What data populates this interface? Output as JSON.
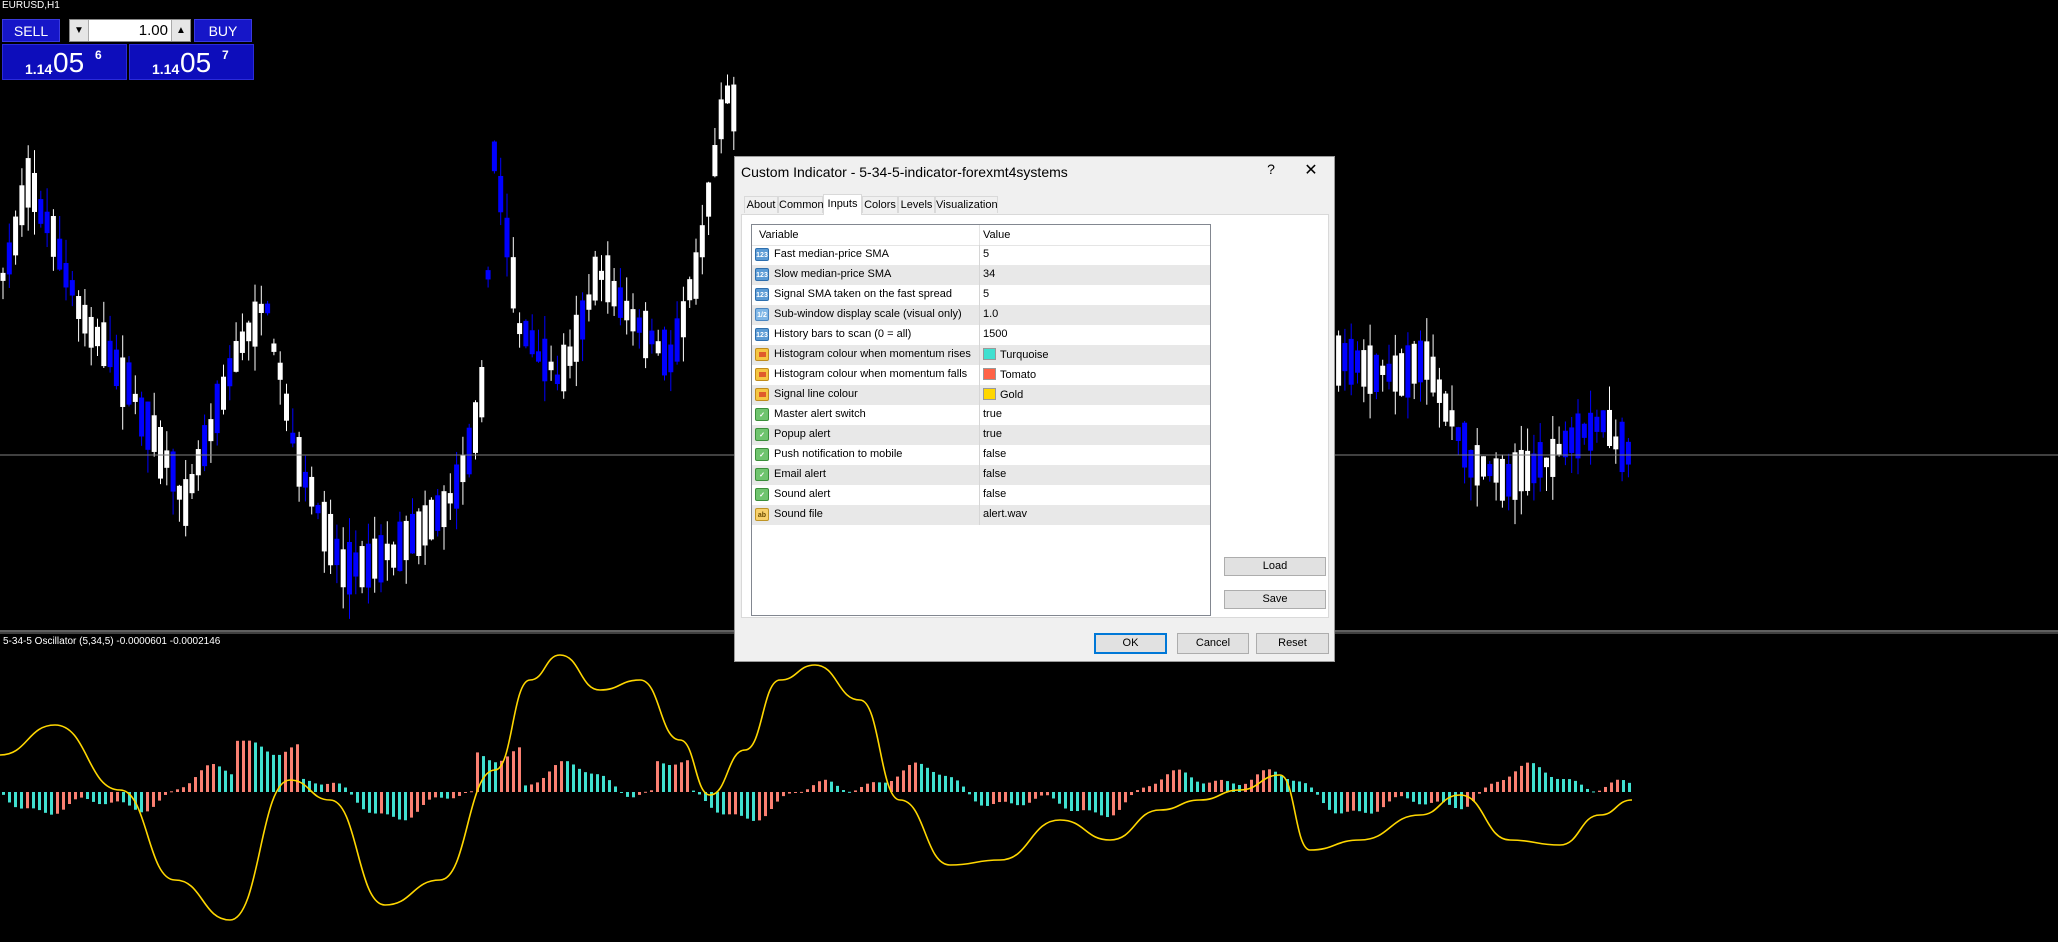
{
  "symbol_label": "EURUSD,H1",
  "oscillator_label": "5-34-5 Oscillator (5,34,5) -0.0000601 -0.0002146",
  "trade_panel": {
    "sell_label": "SELL",
    "buy_label": "BUY",
    "lot_value": "1.00",
    "bid": {
      "prefix": "1.14",
      "big": "05",
      "sup": "6"
    },
    "ask": {
      "prefix": "1.14",
      "big": "05",
      "sup": "7"
    }
  },
  "dialog": {
    "title": "Custom Indicator - 5-34-5-indicator-forexmt4systems",
    "help_label": "?",
    "close_label": "✕",
    "tabs": [
      "About",
      "Common",
      "Inputs",
      "Colors",
      "Levels",
      "Visualization"
    ],
    "active_tab": "Inputs",
    "columns": {
      "variable": "Variable",
      "value": "Value"
    },
    "rows": [
      {
        "type": "int",
        "icon": "123",
        "name": "Fast median-price SMA",
        "value": "5"
      },
      {
        "type": "int",
        "icon": "123",
        "name": "Slow median-price SMA",
        "value": "34"
      },
      {
        "type": "int",
        "icon": "123",
        "name": "Signal SMA taken on the fast spread",
        "value": "5"
      },
      {
        "type": "dbl",
        "icon": "1/2",
        "name": "Sub-window display scale (visual only)",
        "value": "1.0"
      },
      {
        "type": "int",
        "icon": "123",
        "name": "History bars to scan (0 = all)",
        "value": "1500"
      },
      {
        "type": "col",
        "icon": "",
        "name": "Histogram colour when momentum rises",
        "value": "Turquoise",
        "swatch": "#40e0d0"
      },
      {
        "type": "col",
        "icon": "",
        "name": "Histogram colour when momentum falls",
        "value": "Tomato",
        "swatch": "#ff6347"
      },
      {
        "type": "col",
        "icon": "",
        "name": "Signal line colour",
        "value": "Gold",
        "swatch": "#ffd700"
      },
      {
        "type": "bool",
        "icon": "✓",
        "name": "Master alert switch",
        "value": "true"
      },
      {
        "type": "bool",
        "icon": "✓",
        "name": "Popup alert",
        "value": "true"
      },
      {
        "type": "bool",
        "icon": "✓",
        "name": "Push notification to mobile",
        "value": "false"
      },
      {
        "type": "bool",
        "icon": "✓",
        "name": "Email alert",
        "value": "false"
      },
      {
        "type": "bool",
        "icon": "✓",
        "name": "Sound alert",
        "value": "false"
      },
      {
        "type": "str",
        "icon": "ab",
        "name": "Sound file",
        "value": "alert.wav"
      }
    ],
    "load_label": "Load",
    "save_label": "Save",
    "ok_label": "OK",
    "cancel_label": "Cancel",
    "reset_label": "Reset"
  },
  "colors": {
    "bull_candle": "#ffffff",
    "bear_candle": "#0000ff",
    "hist_up": "#40e0d0",
    "hist_down": "#fa8072",
    "signal_line": "#ffd700",
    "separator": "#808080"
  }
}
